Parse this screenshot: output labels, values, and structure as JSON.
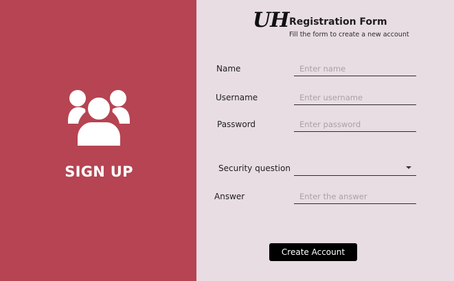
{
  "colors": {
    "accent": "#b64452",
    "panel": "#e8dde3",
    "button": "#000000"
  },
  "left": {
    "icon": "users-group-icon",
    "title": "SIGN UP"
  },
  "header": {
    "logo_text": "UH",
    "title": "Registration Form",
    "subtitle": "Fill the form to create a new account"
  },
  "form": {
    "name": {
      "label": "Name",
      "value": "",
      "placeholder": "Enter name"
    },
    "username": {
      "label": "Username",
      "value": "",
      "placeholder": "Enter username"
    },
    "password": {
      "label": "Password",
      "value": "",
      "placeholder": "Enter password"
    },
    "security_question": {
      "label": "Security question",
      "value": "",
      "icon": "chevron-down-icon"
    },
    "answer": {
      "label": "Answer",
      "value": "",
      "placeholder": "Enter the answer"
    }
  },
  "actions": {
    "create_label": "Create Account"
  }
}
